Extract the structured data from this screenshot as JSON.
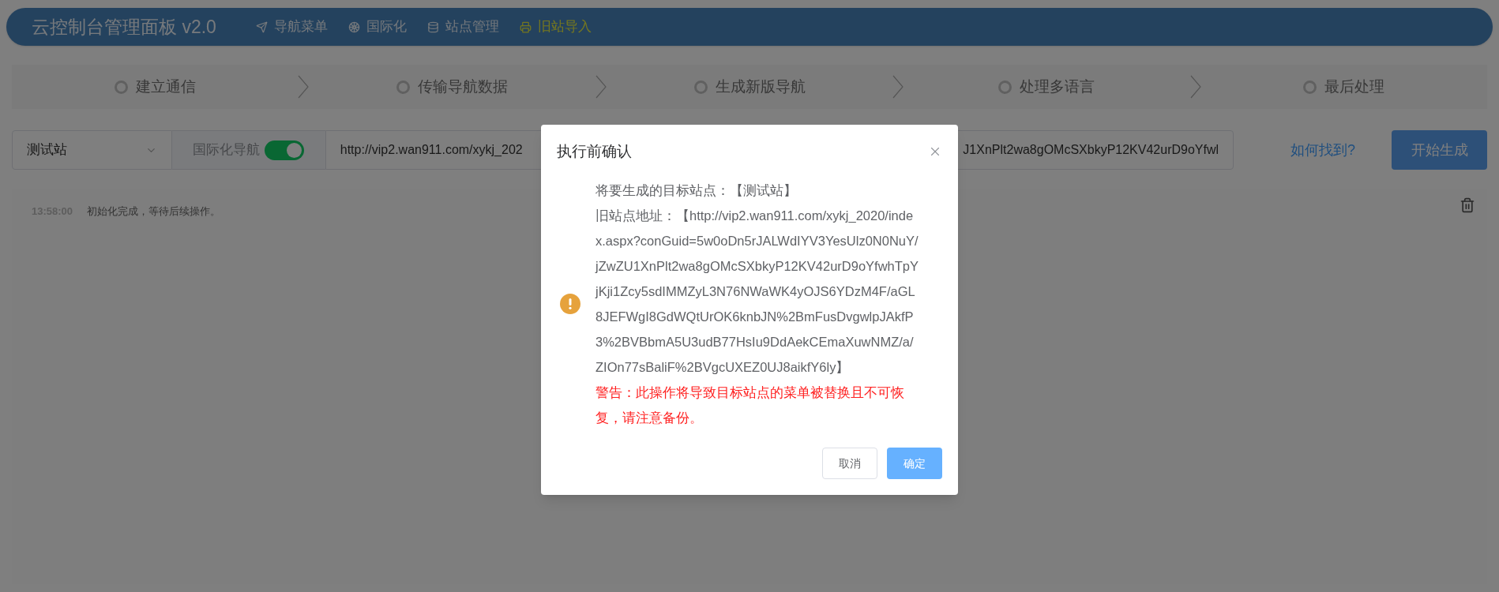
{
  "header": {
    "title": "云控制台管理面板 v2.0",
    "nav": [
      {
        "label": "导航菜单",
        "selected": false
      },
      {
        "label": "国际化",
        "selected": false
      },
      {
        "label": "站点管理",
        "selected": false
      },
      {
        "label": "旧站导入",
        "selected": true
      }
    ]
  },
  "steps": [
    {
      "label": "建立通信",
      "done": false
    },
    {
      "label": "传输导航数据",
      "done": false
    },
    {
      "label": "生成新版导航",
      "done": false
    },
    {
      "label": "处理多语言",
      "done": false
    },
    {
      "label": "最后处理",
      "done": false
    }
  ],
  "toolbar": {
    "site_select": {
      "value": "测试站"
    },
    "intl_nav": {
      "label": "国际化导航",
      "on": true
    },
    "url_field": {
      "value_start": "http://vip2.wan911.com/xykj_202",
      "value_end": "J1XnPlt2wa8gOMcSXbkyP12KV42urD9oYfwl"
    },
    "help_link": "如何找到?",
    "start_button": "开始生成"
  },
  "log": [
    {
      "time": "13:58:00",
      "message": "初始化完成，等待后续操作。"
    }
  ],
  "dialog": {
    "title": "执行前确认",
    "target_line": "将要生成的目标站点：【测试站】",
    "address_line": "旧站点地址：【http://vip2.wan911.com/xykj_2020/index.aspx?conGuid=5w0oDn5rJALWdIYV3YesUlz0N0NuY/jZwZU1XnPlt2wa8gOMcSXbkyP12KV42urD9oYfwhTpYjKji1Zcy5sdIMMZyL3N76NWaWK4yOJS6YDzM4F/aGL8JEFWgI8GdWQtUrOK6knbJN%2BmFusDvgwlpJAkfP3%2BVBbmA5U3udB77HsIu9DdAekCEmaXuwNMZ/a/ZIOn77sBaliF%2BVgcUXEZ0UJ8aikfY6ly】",
    "warning": "警告：此操作将导致目标站点的菜单被替换且不可恢复，请注意备份。",
    "cancel": "取消",
    "confirm": "确定"
  }
}
